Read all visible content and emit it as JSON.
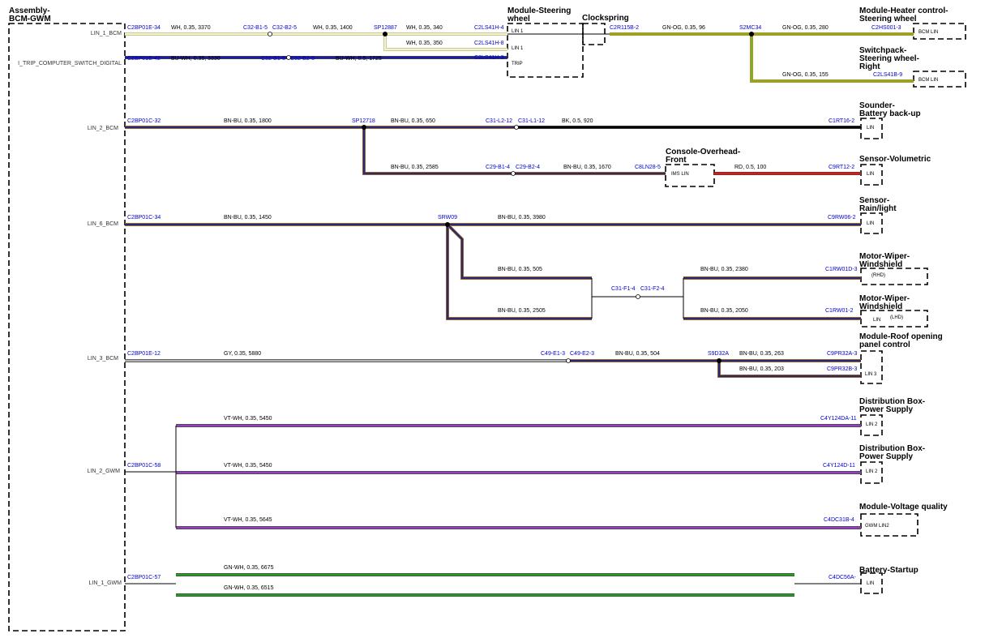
{
  "colors": {
    "WH": "#f3f3cc",
    "BU-WH": "#1a1aa8",
    "GN-OG": "#7fae2a",
    "BN-BU": "#2a2a70",
    "BK": "#000000",
    "RD": "#ee1111",
    "GY": "#b4b4b4",
    "VT-WH": "#9040c0",
    "GN-WH": "#22a022"
  },
  "modules": {
    "bcm": "Assembly-\nBCM-GWM",
    "steering_wheel": "Module-Steering\nwheel",
    "clockspring": "Clockspring",
    "heater": "Module-Heater control-\nSteering wheel",
    "switchpack": "Switchpack-\nSteering wheel-\nRight",
    "sounder": "Sounder-\nBattery back-up",
    "console": "Console-Overhead-\nFront",
    "volumetric": "Sensor-Volumetric",
    "rainlight": "Sensor-\nRain/light",
    "wiper_rhd": "Motor-Wiper-\nWindshield",
    "wiper_lhd": "Motor-Wiper-\nWindshield",
    "roof": "Module-Roof opening\npanel control",
    "distbox1": "Distribution Box-\nPower Supply",
    "distbox2": "Distribution Box-\nPower Supply",
    "voltage": "Module-Voltage quality",
    "battery": "Battery-Startup"
  },
  "signals": {
    "lin1_bcm": "LIN_1_BCM",
    "itrip": "I_TRIP_COMPUTER_SWITCH_DIGITAL",
    "lin2_bcm": "LIN_2_BCM",
    "lin6_bcm": "LIN_6_BCM",
    "lin3_bcm": "LIN_3_BCM",
    "lin2_gwm": "LIN_2_GWM",
    "lin1_gwm": "LIN_1_GWM"
  },
  "pin_labels": {
    "sw_lin1a": "LIN 1",
    "sw_lin1b": "LIN 1",
    "sw_trip": "TRIP",
    "heater": "BCM LIN",
    "switchpack": "BCM LIN",
    "sounder": "LIN",
    "console": "IMS LIN",
    "volumetric": "LIN",
    "rainlight": "LIN",
    "wiper_rhd": "(RHD)",
    "wiper_lhd_lin": "LIN",
    "wiper_lhd": "(LHD)",
    "roof": "LIN 3",
    "distbox1": "LIN 2",
    "distbox2": "LIN 2",
    "voltage": "GWM LIN2",
    "battery": "LIN"
  },
  "pins": {
    "c2bp01e34": "C2BP01E-34",
    "c32b15": "C32-B1-5",
    "c32b25": "C32-B2-5",
    "sp12887": "SP12887",
    "c2ls41h4": "C2LS41H-4",
    "c2ls41h8": "C2LS41H-8",
    "c2bp01e42": "C2BP01E-42",
    "c32b18": "C32-B1-8",
    "c32b28": "C32-B2-8",
    "c2ls41h3": "C2LS41H-3",
    "c2r115b2": "C2R115B-2",
    "s2mc34": "S2MC34",
    "c2hs001_3": "C2HS001-3",
    "c2ls41b9": "C2LS41B-9",
    "c2bp01c32": "C2BP01C-32",
    "sp12718": "SP12718",
    "c31l212": "C31-L2-12",
    "c31l112": "C31-L1-12",
    "c1rt16_2": "C1RT16-2",
    "c29b14": "C29-B1-4",
    "c29b24": "C29-B2-4",
    "c8ln28_5": "C8LN28-5",
    "c9rt12_2": "C9RT12-2",
    "c2bp01c34": "C2BP01C-34",
    "srw09": "SRW09",
    "c9rw06_2": "C9RW06-2",
    "c31f14": "C31-F1-4",
    "c31f24": "C31-F2-4",
    "c1rw01d3": "C1RW01D-3",
    "c1rw01_2": "C1RW01-2",
    "c2bp01e12": "C2BP01E-12",
    "c49e13": "C49-E1-3",
    "c49e23": "C49-E2-3",
    "s9d32a": "S9D32A",
    "c9pr32a3": "C9PR32A-3",
    "c9pr32b3": "C9PR32B-3",
    "c2bp01c58": "C2BP01C-58",
    "c4y124da11": "C4Y124DA-11",
    "c4y124d11": "C4Y124D-11",
    "c4dc31b4": "C4DC31B-4",
    "c2bp01c57": "C2BP01C-57",
    "c4dc56a": "C4DC56A-"
  },
  "wires": {
    "w1": "WH, 0.35, 3370",
    "w2": "WH, 0.35, 1400",
    "w3": "WH, 0.35, 340",
    "w4": "WH, 0.35, 350",
    "w5": "BU-WH, 0.35, 3330",
    "w6": "BU-WH, 0.5, 1725",
    "w7": "GN-OG, 0.35, 96",
    "w8": "GN-OG, 0.35, 280",
    "w9": "GN-OG, 0.35, 155",
    "w10": "BN-BU, 0.35, 1800",
    "w11": "BN-BU, 0.35, 650",
    "w12": "BK, 0.5, 920",
    "w13": "BN-BU, 0.35, 2585",
    "w14": "BN-BU, 0.35, 1670",
    "w15": "RD, 0.5, 100",
    "w16": "BN-BU, 0.35, 1450",
    "w17": "BN-BU, 0.35, 3980",
    "w18": "BN-BU, 0.35, 505",
    "w19": "BN-BU, 0.35, 2505",
    "w20": "BN-BU, 0.35, 2380",
    "w21": "BN-BU, 0.35, 2050",
    "w22": "GY, 0.35, 5880",
    "w23": "BN-BU, 0.35, 504",
    "w24": "BN-BU, 0.35, 263",
    "w25": "BN-BU, 0.35, 203",
    "w26": "VT-WH, 0.35, 5450",
    "w27": "VT-WH, 0.35, 5450",
    "w28": "VT-WH, 0.35, 5645",
    "w29": "GN-WH, 0.35, 6675",
    "w30": "GN-WH, 0.35, 6515"
  }
}
